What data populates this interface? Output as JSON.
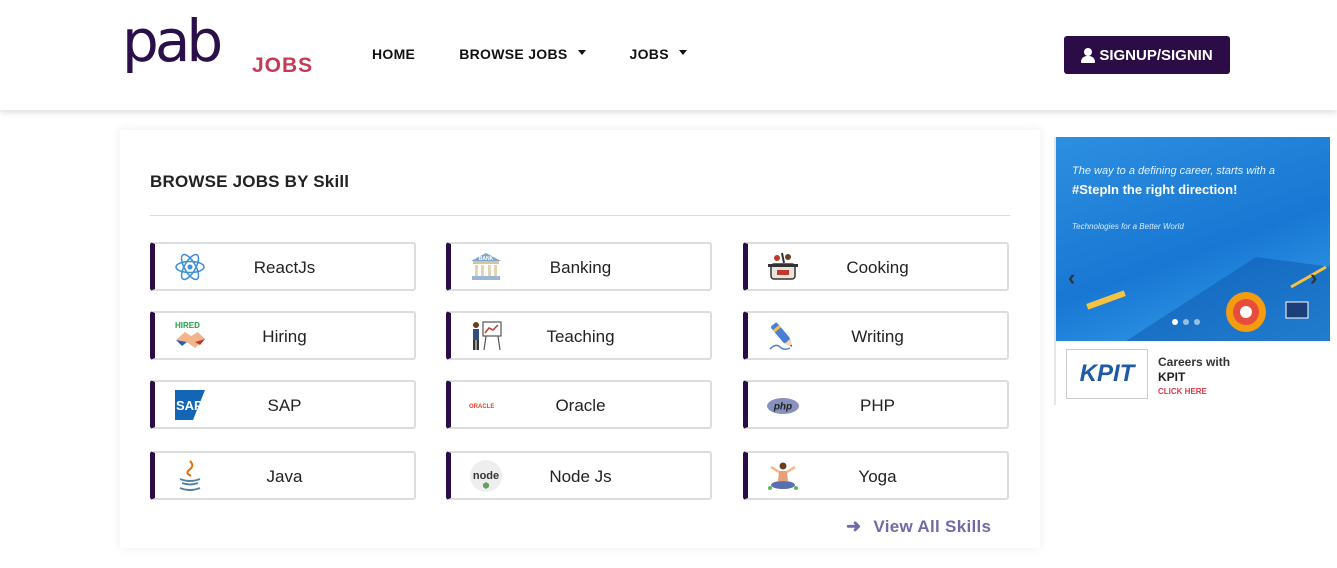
{
  "header": {
    "logo_main": "pab",
    "logo_sub": "JOBS",
    "nav": [
      {
        "label": "HOME",
        "dropdown": false
      },
      {
        "label": "BROWSE JOBS",
        "dropdown": true
      },
      {
        "label": "JOBS",
        "dropdown": true
      }
    ],
    "signup_label": "SIGNUP/SIGNIN"
  },
  "main": {
    "title": "BROWSE JOBS BY Skill",
    "skills": [
      {
        "label": "ReactJs",
        "icon": "react-icon"
      },
      {
        "label": "Banking",
        "icon": "bank-icon"
      },
      {
        "label": "Cooking",
        "icon": "cooking-pot-icon"
      },
      {
        "label": "Hiring",
        "icon": "handshake-icon"
      },
      {
        "label": "Teaching",
        "icon": "teacher-icon"
      },
      {
        "label": "Writing",
        "icon": "pen-icon"
      },
      {
        "label": "SAP",
        "icon": "sap-logo-icon"
      },
      {
        "label": "Oracle",
        "icon": "oracle-logo-icon"
      },
      {
        "label": "PHP",
        "icon": "php-logo-icon"
      },
      {
        "label": "Java",
        "icon": "java-cup-icon"
      },
      {
        "label": "Node Js",
        "icon": "node-logo-icon"
      },
      {
        "label": "Yoga",
        "icon": "yoga-icon"
      }
    ],
    "icon_text": {
      "bank": "BANK",
      "hired": "HIRED",
      "sap": "SAP",
      "oracle": "ORACLE",
      "php": "php",
      "node": "node"
    },
    "view_all_label": "View All Skills"
  },
  "banner": {
    "line1": "The way to a defining career, starts with a",
    "line2": "#StepIn the right direction!",
    "line3": "Technologies for a Better World",
    "kpit_logo": "KPIT",
    "careers_line1": "Careers with",
    "careers_line2": "KPIT",
    "cta": "CLICK HERE"
  },
  "colors": {
    "brand": "#2b0c46",
    "logo_accent": "#c33b55",
    "link": "#6f6aa8",
    "banner_blue": "#1877d3"
  }
}
